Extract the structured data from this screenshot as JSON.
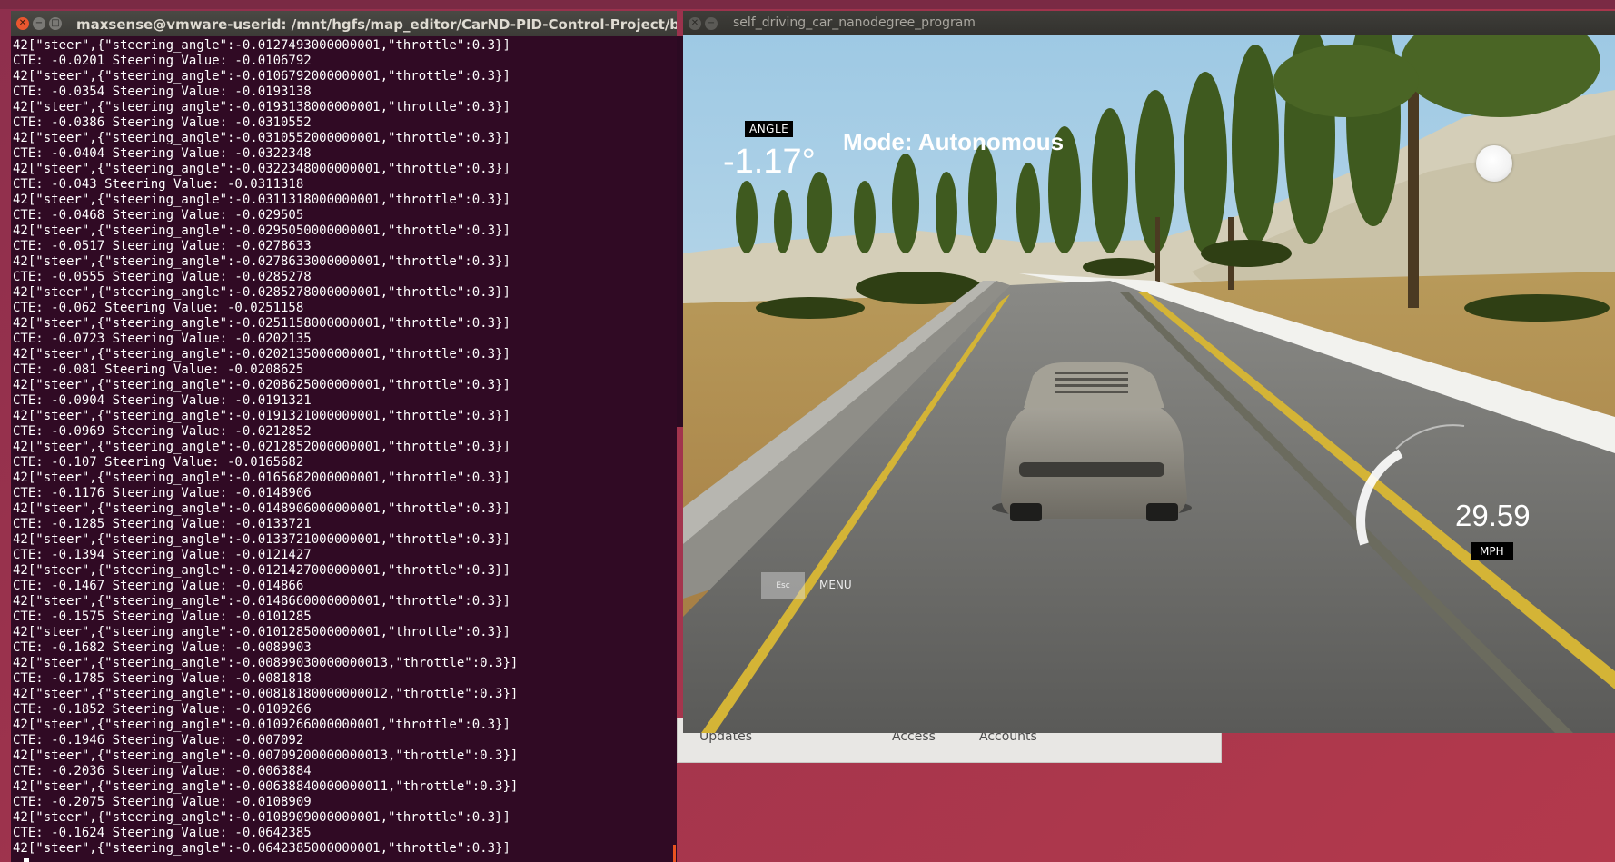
{
  "terminal": {
    "title": "maxsense@vmware-userid: /mnt/hgfs/map_editor/CarND-PID-Control-Project/build",
    "lines": [
      "42[\"steer\",{\"steering_angle\":-0.0127493000000001,\"throttle\":0.3}]",
      "CTE: -0.0201 Steering Value: -0.0106792",
      "42[\"steer\",{\"steering_angle\":-0.0106792000000001,\"throttle\":0.3}]",
      "CTE: -0.0354 Steering Value: -0.0193138",
      "42[\"steer\",{\"steering_angle\":-0.0193138000000001,\"throttle\":0.3}]",
      "CTE: -0.0386 Steering Value: -0.0310552",
      "42[\"steer\",{\"steering_angle\":-0.0310552000000001,\"throttle\":0.3}]",
      "CTE: -0.0404 Steering Value: -0.0322348",
      "42[\"steer\",{\"steering_angle\":-0.0322348000000001,\"throttle\":0.3}]",
      "CTE: -0.043 Steering Value: -0.0311318",
      "42[\"steer\",{\"steering_angle\":-0.0311318000000001,\"throttle\":0.3}]",
      "CTE: -0.0468 Steering Value: -0.029505",
      "42[\"steer\",{\"steering_angle\":-0.0295050000000001,\"throttle\":0.3}]",
      "CTE: -0.0517 Steering Value: -0.0278633",
      "42[\"steer\",{\"steering_angle\":-0.0278633000000001,\"throttle\":0.3}]",
      "CTE: -0.0555 Steering Value: -0.0285278",
      "42[\"steer\",{\"steering_angle\":-0.0285278000000001,\"throttle\":0.3}]",
      "CTE: -0.062 Steering Value: -0.0251158",
      "42[\"steer\",{\"steering_angle\":-0.0251158000000001,\"throttle\":0.3}]",
      "CTE: -0.0723 Steering Value: -0.0202135",
      "42[\"steer\",{\"steering_angle\":-0.0202135000000001,\"throttle\":0.3}]",
      "CTE: -0.081 Steering Value: -0.0208625",
      "42[\"steer\",{\"steering_angle\":-0.0208625000000001,\"throttle\":0.3}]",
      "CTE: -0.0904 Steering Value: -0.0191321",
      "42[\"steer\",{\"steering_angle\":-0.0191321000000001,\"throttle\":0.3}]",
      "CTE: -0.0969 Steering Value: -0.0212852",
      "42[\"steer\",{\"steering_angle\":-0.0212852000000001,\"throttle\":0.3}]",
      "CTE: -0.107 Steering Value: -0.0165682",
      "42[\"steer\",{\"steering_angle\":-0.0165682000000001,\"throttle\":0.3}]",
      "CTE: -0.1176 Steering Value: -0.0148906",
      "42[\"steer\",{\"steering_angle\":-0.0148906000000001,\"throttle\":0.3}]",
      "CTE: -0.1285 Steering Value: -0.0133721",
      "42[\"steer\",{\"steering_angle\":-0.0133721000000001,\"throttle\":0.3}]",
      "CTE: -0.1394 Steering Value: -0.0121427",
      "42[\"steer\",{\"steering_angle\":-0.0121427000000001,\"throttle\":0.3}]",
      "CTE: -0.1467 Steering Value: -0.014866",
      "42[\"steer\",{\"steering_angle\":-0.0148660000000001,\"throttle\":0.3}]",
      "CTE: -0.1575 Steering Value: -0.0101285",
      "42[\"steer\",{\"steering_angle\":-0.0101285000000001,\"throttle\":0.3}]",
      "CTE: -0.1682 Steering Value: -0.0089903",
      "42[\"steer\",{\"steering_angle\":-0.00899030000000013,\"throttle\":0.3}]",
      "CTE: -0.1785 Steering Value: -0.0081818",
      "42[\"steer\",{\"steering_angle\":-0.00818180000000012,\"throttle\":0.3}]",
      "CTE: -0.1852 Steering Value: -0.0109266",
      "42[\"steer\",{\"steering_angle\":-0.0109266000000001,\"throttle\":0.3}]",
      "CTE: -0.1946 Steering Value: -0.007092",
      "42[\"steer\",{\"steering_angle\":-0.00709200000000013,\"throttle\":0.3}]",
      "CTE: -0.2036 Steering Value: -0.0063884",
      "42[\"steer\",{\"steering_angle\":-0.00638840000000011,\"throttle\":0.3}]",
      "CTE: -0.2075 Steering Value: -0.0108909",
      "42[\"steer\",{\"steering_angle\":-0.0108909000000001,\"throttle\":0.3}]",
      "CTE: -0.1624 Steering Value: -0.0642385",
      "42[\"steer\",{\"steering_angle\":-0.0642385000000001,\"throttle\":0.3}]"
    ]
  },
  "simulator": {
    "title": "self_driving_car_nanodegree_program",
    "angle_label": "ANGLE",
    "angle_value": "-1.17°",
    "mode": "Mode: Autonomous",
    "speed": "29.59",
    "speed_unit": "MPH",
    "esc_label": "Esc",
    "menu_label": "MENU"
  },
  "background_window": {
    "items": [
      "Updates",
      "Access",
      "Accounts"
    ]
  },
  "colors": {
    "terminal_bg": "#300a24",
    "desktop_bg": "#a0344d",
    "close_button": "#e9562f"
  }
}
